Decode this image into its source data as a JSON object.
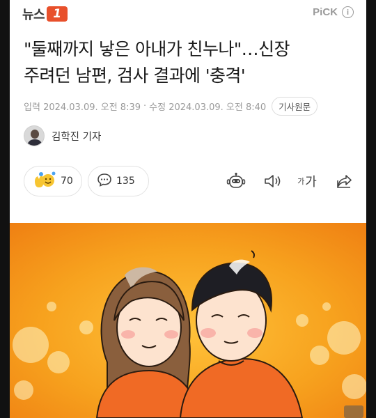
{
  "header": {
    "logo_text": "뉴스",
    "logo_badge": "1",
    "pick_label": "PiCK",
    "info_icon": "i"
  },
  "article": {
    "headline_line1": "\"둘째까지 낳은 아내가 친누나\"…신장",
    "headline_line2": "주려던 남편, 검사 결과에 '충격'",
    "published_label": "입력",
    "published": "2024.03.09. 오전 8:39",
    "separator": "·",
    "modified_label": "수정",
    "modified": "2024.03.09. 오전 8:40",
    "source_button": "기사원문",
    "reporter": "김학진 기자"
  },
  "actions": {
    "reaction_count": "70",
    "comment_count": "135",
    "font_size_label_small": "가",
    "font_size_label_large": "가"
  },
  "icons": {
    "reaction": "reaction-emoji-icon",
    "comment": "comment-bubble-icon",
    "summary": "robot-summary-icon",
    "audio": "speaker-icon",
    "font": "font-size-icon",
    "share": "share-icon"
  },
  "colors": {
    "brand_orange": "#e8502b",
    "illustration_bg": "#f5a21c"
  }
}
